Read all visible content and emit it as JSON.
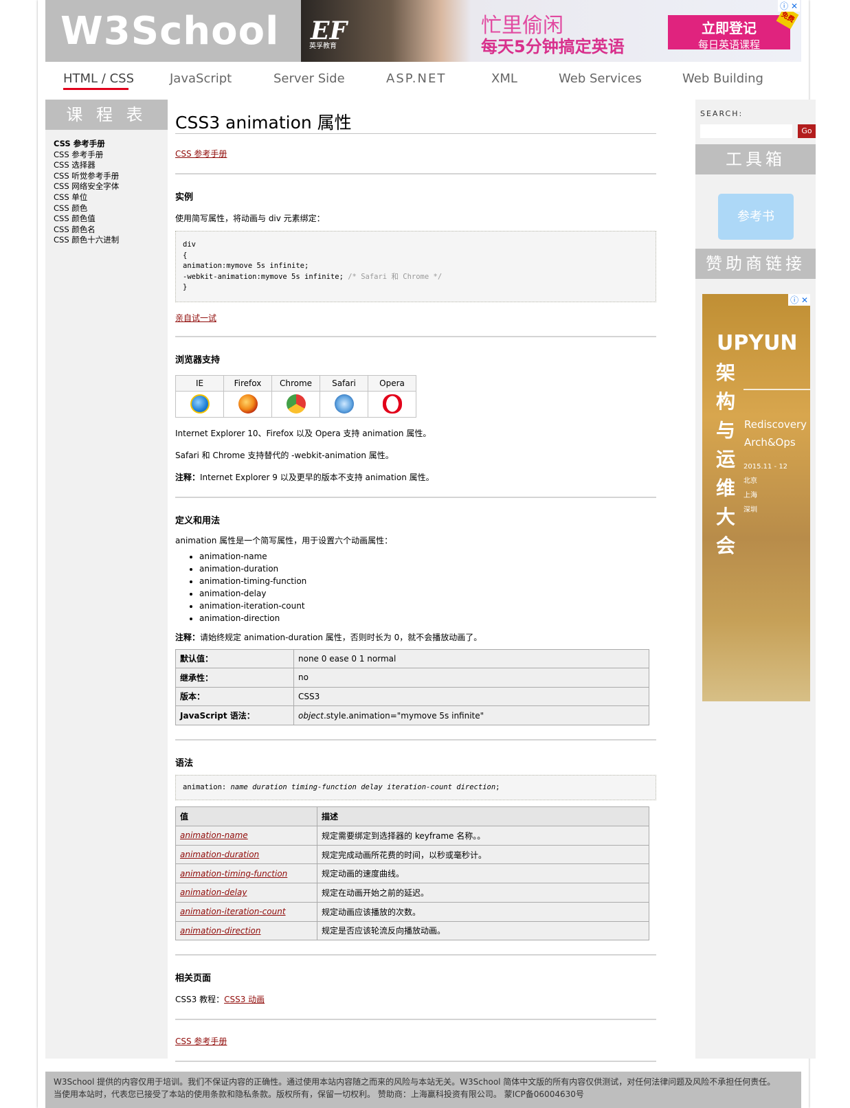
{
  "header": {
    "logo": "W3School",
    "ad": {
      "brand": "EF",
      "brand_sub": "英孚教育",
      "line1": "忙里偷闲",
      "line2": "每天5分钟搞定英语",
      "cta_1": "立即登记",
      "cta_2": "每日英语课程",
      "badge": "免费"
    }
  },
  "nav": [
    "HTML / CSS",
    "JavaScript",
    "Server Side",
    "ASP.NET",
    "XML",
    "Web Services",
    "Web Building"
  ],
  "course": {
    "title": "课 程 表",
    "head": "CSS 参考手册",
    "items": [
      "CSS 参考手册",
      "CSS 选择器",
      "CSS 听觉参考手册",
      "CSS 网络安全字体",
      "CSS 单位",
      "CSS 颜色",
      "CSS 颜色值",
      "CSS 颜色名",
      "CSS 颜色十六进制"
    ]
  },
  "main": {
    "title": "CSS3 animation 属性",
    "ref_link": "CSS 参考手册",
    "example": {
      "heading": "实例",
      "desc": "使用简写属性，将动画与 div 元素绑定：",
      "code": [
        "div",
        "{",
        "animation:mymove 5s infinite;",
        "-webkit-animation:mymove 5s infinite;"
      ],
      "code_comment": "/* Safari 和 Chrome */",
      "code_end": "}",
      "try_link": "亲自试一试"
    },
    "browser": {
      "heading": "浏览器支持",
      "names": [
        "IE",
        "Firefox",
        "Chrome",
        "Safari",
        "Opera"
      ],
      "p1": "Internet Explorer 10、Firefox 以及 Opera 支持 animation 属性。",
      "p2": "Safari 和 Chrome 支持替代的 -webkit-animation 属性。",
      "note_label": "注释：",
      "note": "Internet Explorer 9 以及更早的版本不支持 animation 属性。"
    },
    "definition": {
      "heading": "定义和用法",
      "desc": "animation 属性是一个简写属性，用于设置六个动画属性：",
      "props": [
        "animation-name",
        "animation-duration",
        "animation-timing-function",
        "animation-delay",
        "animation-iteration-count",
        "animation-direction"
      ],
      "note_label": "注释：",
      "note": "请始终规定 animation-duration 属性，否则时长为 0，就不会播放动画了。",
      "info": [
        {
          "k": "默认值：",
          "v": "none 0 ease 0 1 normal"
        },
        {
          "k": "继承性：",
          "v": "no"
        },
        {
          "k": "版本：",
          "v": "CSS3"
        },
        {
          "k": "JavaScript 语法：",
          "v_ital": "object",
          "v": ".style.animation=\"mymove 5s infinite\""
        }
      ]
    },
    "syntax": {
      "heading": "语法",
      "code_prefix": "animation: ",
      "code_args": "name duration timing-function delay iteration-count direction",
      "code_suffix": ";",
      "col_value": "值",
      "col_desc": "描述",
      "rows": [
        {
          "v": "animation-name",
          "d": "规定需要绑定到选择器的 keyframe 名称。。"
        },
        {
          "v": "animation-duration",
          "d": "规定完成动画所花费的时间，以秒或毫秒计。"
        },
        {
          "v": "animation-timing-function",
          "d": "规定动画的速度曲线。"
        },
        {
          "v": "animation-delay",
          "d": "规定在动画开始之前的延迟。"
        },
        {
          "v": "animation-iteration-count",
          "d": "规定动画应该播放的次数。"
        },
        {
          "v": "animation-direction",
          "d": "规定是否应该轮流反向播放动画。"
        }
      ]
    },
    "related": {
      "heading": "相关页面",
      "label": "CSS3 教程：",
      "link": "CSS3 动画"
    },
    "bottom_link": "CSS 参考手册"
  },
  "sidebar": {
    "search_label": "SEARCH:",
    "go": "Go",
    "toolbox": "工具箱",
    "refbook": "参考书",
    "sponsor": "赞助商链接",
    "ad": {
      "brand": "UPYUN",
      "vertical": "架构与运维大会",
      "line1": "Rediscovery",
      "line2": "Arch&Ops",
      "date": "2015.11 - 12",
      "cities": [
        "北京",
        "上海",
        "深圳"
      ]
    }
  },
  "footer": {
    "line1": "W3School 提供的内容仅用于培训。我们不保证内容的正确性。通过使用本站内容随之而来的风险与本站无关。W3School 简体中文版的所有内容仅供测试，对任何法律问题及风险不承担任何责任。",
    "line2": "当使用本站时，代表您已接受了本站的使用条款和隐私条款。版权所有，保留一切权利。 赞助商：上海赢科投资有限公司。 蒙ICP备06004630号"
  },
  "colors": {
    "link": "#900b09",
    "nav_underline": "#e0001b",
    "panel_header": "#bebebe",
    "go_button": "#b31d1d"
  }
}
